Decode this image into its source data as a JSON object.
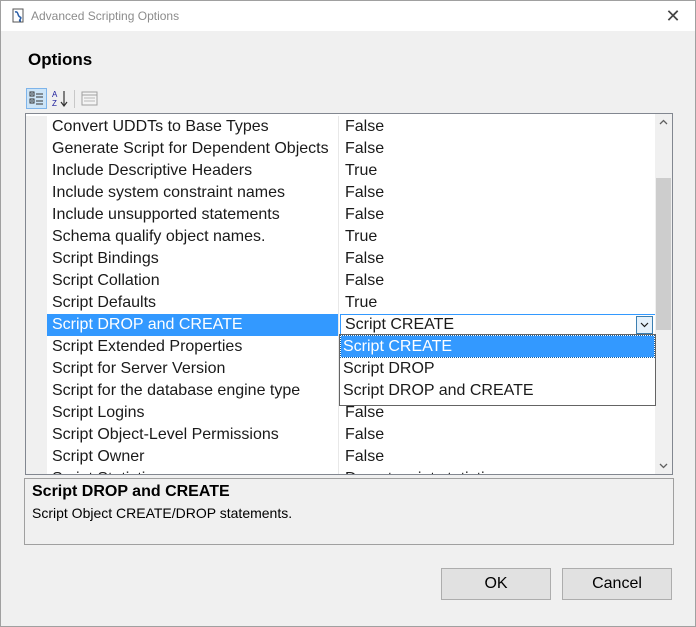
{
  "window": {
    "title": "Advanced Scripting Options",
    "close_glyph": "✕"
  },
  "options_heading": "Options",
  "grid": {
    "rows": [
      {
        "name": "Convert UDDTs to Base Types",
        "value": "False"
      },
      {
        "name": "Generate Script for Dependent Objects",
        "value": "False"
      },
      {
        "name": "Include Descriptive Headers",
        "value": "True"
      },
      {
        "name": "Include system constraint names",
        "value": "False"
      },
      {
        "name": "Include unsupported statements",
        "value": "False"
      },
      {
        "name": "Schema qualify object names.",
        "value": "True"
      },
      {
        "name": "Script Bindings",
        "value": "False"
      },
      {
        "name": "Script Collation",
        "value": "False"
      },
      {
        "name": "Script Defaults",
        "value": "True"
      },
      {
        "name": "Script DROP and CREATE",
        "value": "Script CREATE"
      },
      {
        "name": "Script Extended Properties",
        "value": ""
      },
      {
        "name": "Script for Server Version",
        "value": ""
      },
      {
        "name": "Script for the database engine type",
        "value": ""
      },
      {
        "name": "Script Logins",
        "value": "False"
      },
      {
        "name": "Script Object-Level Permissions",
        "value": "False"
      },
      {
        "name": "Script Owner",
        "value": "False"
      },
      {
        "name": "Script Statistics",
        "value": "Do not script statistics"
      }
    ],
    "selected_index": 9
  },
  "dropdown": {
    "options": [
      "Script CREATE",
      "Script DROP",
      "Script DROP and CREATE"
    ],
    "highlighted_index": 0
  },
  "description": {
    "title": "Script DROP and CREATE",
    "text": "Script Object CREATE/DROP statements."
  },
  "buttons": {
    "ok": "OK",
    "cancel": "Cancel"
  },
  "icons": {
    "app": "script-options-icon",
    "categorized": "categorized-view-icon",
    "alphabetical": "alphabetical-sort-icon",
    "property_pages": "property-pages-icon"
  },
  "colors": {
    "selection": "#3399ff",
    "window_bg": "#f0f0f0"
  }
}
